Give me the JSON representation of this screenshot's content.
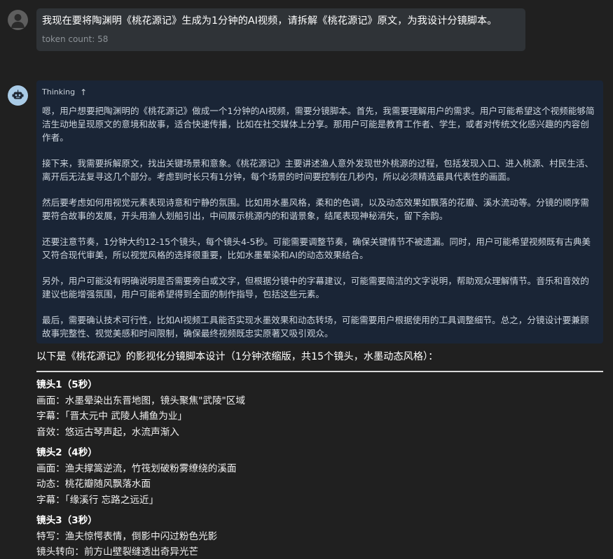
{
  "user": {
    "message": "我现在要将陶渊明《桃花源记》生成为1分钟的AI视频，请拆解《桃花源记》原文，为我设计分镜脚本。",
    "token_count": "token count: 58",
    "avatar_icon": "user-silhouette-icon"
  },
  "assistant": {
    "avatar_icon": "robot-icon",
    "thinking": {
      "label": "Thinking",
      "toggle_icon": "arrow-up-icon",
      "paragraphs": [
        "嗯，用户想要把陶渊明的《桃花源记》做成一个1分钟的AI视频，需要分镜脚本。首先，我需要理解用户的需求。用户可能希望这个视频能够简洁生动地呈现原文的意境和故事，适合快速传播，比如在社交媒体上分享。那用户可能是教育工作者、学生，或者对传统文化感兴趣的内容创作者。",
        "接下来，我需要拆解原文，找出关键场景和意象。《桃花源记》主要讲述渔人意外发现世外桃源的过程，包括发现入口、进入桃源、村民生活、离开后无法复寻这几个部分。考虑到时长只有1分钟，每个场景的时间要控制在几秒内，所以必须精选最具代表性的画面。",
        "然后要考虑如何用视觉元素表现诗意和宁静的氛围。比如用水墨风格，柔和的色调，以及动态效果如飘落的花瓣、溪水流动等。分镜的顺序需要符合故事的发展，开头用渔人划船引出，中间展示桃源内的和谐景象，结尾表现神秘消失，留下余韵。",
        "还要注意节奏，1分钟大约12-15个镜头，每个镜头4-5秒。可能需要调整节奏，确保关键情节不被遗漏。同时，用户可能希望视频既有古典美又符合现代审美，所以视觉风格的选择很重要，比如水墨晕染和AI的动态效果结合。",
        "另外，用户可能没有明确说明是否需要旁白或文字，但根据分镜中的字幕建议，可能需要简洁的文字说明，帮助观众理解情节。音乐和音效的建议也能增强氛围，用户可能希望得到全面的制作指导，包括这些元素。",
        "最后，需要确认技术可行性，比如AI视频工具能否实现水墨效果和动态转场，可能需要用户根据使用的工具调整细节。总之，分镜设计要兼顾故事完整性、视觉美感和时间限制，确保最终视频既忠实原著又吸引观众。"
      ]
    },
    "answer": {
      "intro": "以下是《桃花源记》的影视化分镜脚本设计（1分钟浓缩版，共15个镜头，水墨动态风格）：",
      "shots": [
        {
          "title": "镜头1（5秒）",
          "lines": [
            "画面：水墨晕染出东晋地图，镜头聚焦\"武陵\"区域",
            "字幕：「晋太元中 武陵人捕鱼为业」",
            "音效：悠远古琴声起，水流声渐入"
          ]
        },
        {
          "title": "镜头2（4秒）",
          "lines": [
            "画面：渔夫撑篙逆流，竹筏划破粉雾缭绕的溪面",
            "动态：桃花瓣随风飘落水面",
            "字幕：「缘溪行 忘路之远近」"
          ]
        },
        {
          "title": "镜头3（3秒）",
          "lines": [
            "特写：渔夫惊愕表情，倒影中闪过粉色光影",
            "镜头转向：前方山壁裂缝透出奇异光芒"
          ]
        }
      ]
    }
  }
}
